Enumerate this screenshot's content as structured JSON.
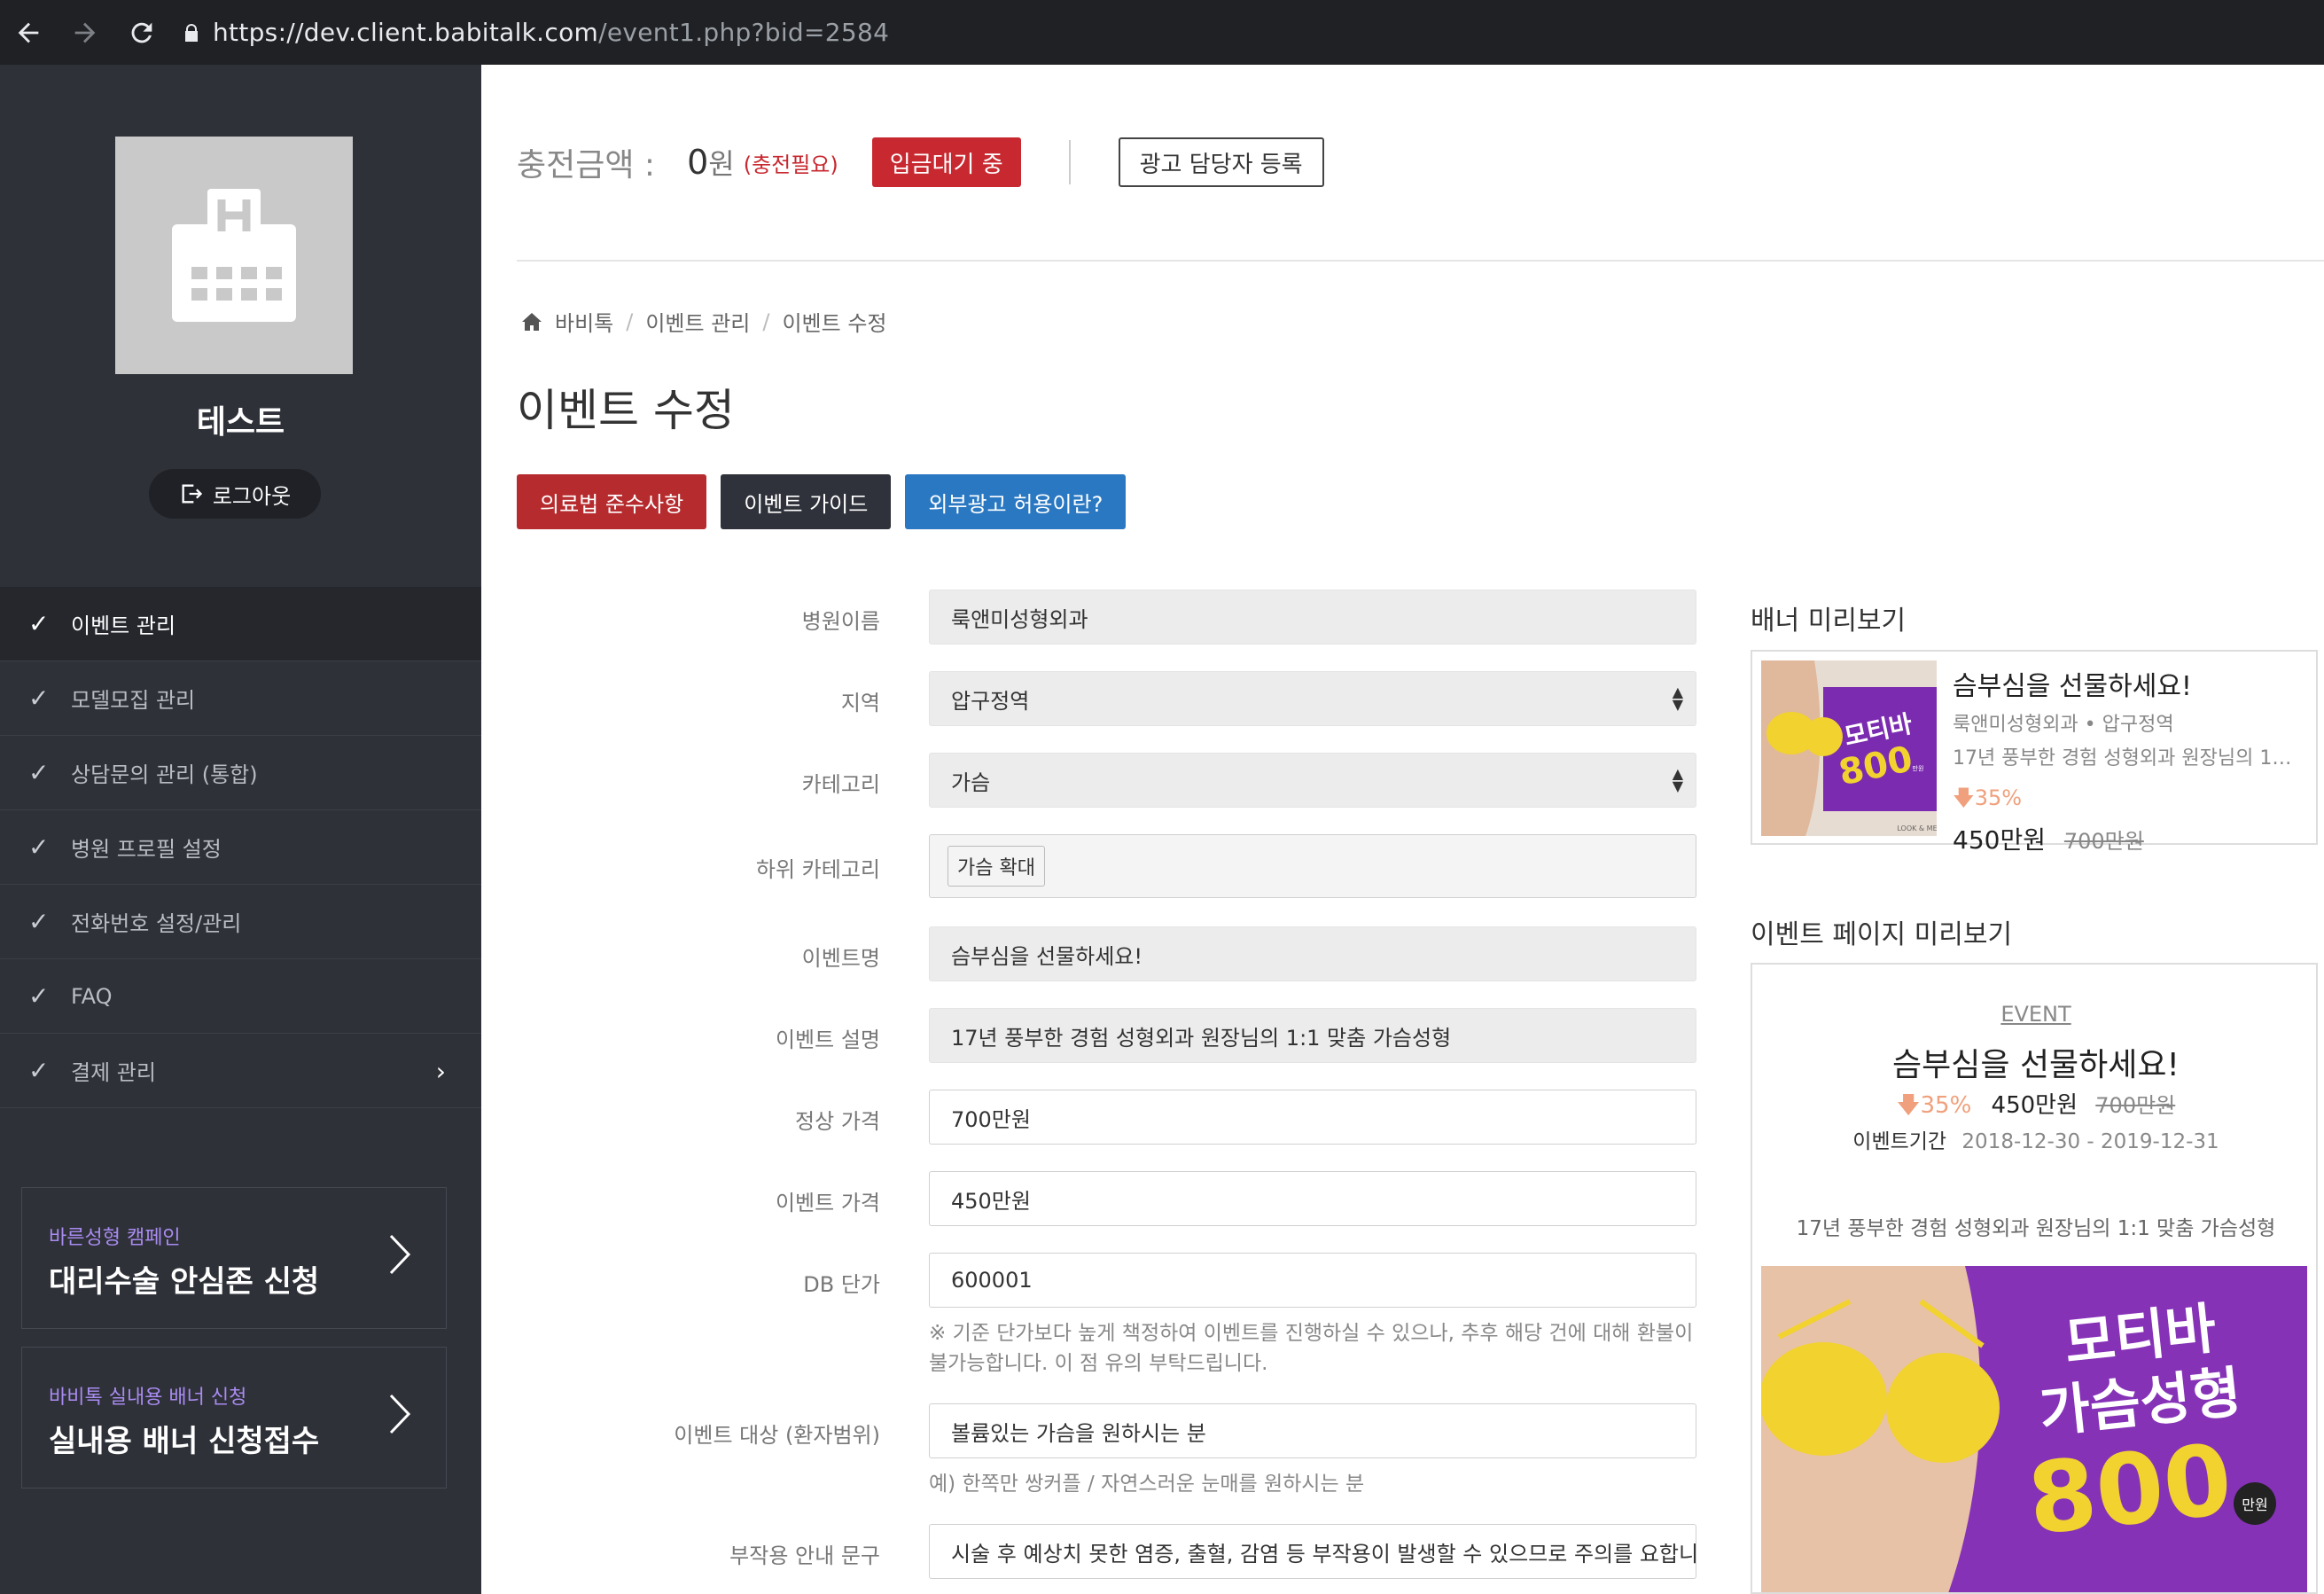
{
  "browser": {
    "url_host": "https://dev.client.babitalk.com",
    "url_path": "/event1.php?bid=2584"
  },
  "sidebar": {
    "clinic_name": "테스트",
    "logout_label": "로그아웃",
    "menu": [
      {
        "label": "이벤트 관리",
        "active": true
      },
      {
        "label": "모델모집 관리"
      },
      {
        "label": "상담문의 관리 (통합)"
      },
      {
        "label": "병원 프로필 설정"
      },
      {
        "label": "전화번호 설정/관리"
      },
      {
        "label": "FAQ"
      },
      {
        "label": "결제 관리",
        "has_arrow": true
      }
    ],
    "promos": [
      {
        "small": "바른성형 캠페인",
        "big": "대리수술 안심존 신청"
      },
      {
        "small": "바비톡 실내용 배너 신청",
        "big": "실내용 배너 신청접수"
      }
    ]
  },
  "header": {
    "charge_label": "충전금액 :",
    "charge_amount": "0",
    "charge_unit": "원",
    "charge_need": "(충전필요)",
    "deposit_status": "입금대기 중",
    "register_manager": "광고 담당자 등록"
  },
  "breadcrumb": {
    "home": "바비톡",
    "sep": "/",
    "level1": "이벤트 관리",
    "level2": "이벤트 수정"
  },
  "page_title": "이벤트 수정",
  "action_buttons": {
    "medical_law": "의료법 준수사항",
    "event_guide": "이벤트 가이드",
    "external_ad": "외부광고 허용이란?"
  },
  "form": {
    "hospital_name": {
      "label": "병원이름",
      "value": "룩앤미성형외과"
    },
    "region": {
      "label": "지역",
      "value": "압구정역"
    },
    "category": {
      "label": "카테고리",
      "value": "가슴"
    },
    "subcategory": {
      "label": "하위 카테고리",
      "tag": "가슴 확대"
    },
    "event_name": {
      "label": "이벤트명",
      "value": "슴부심을 선물하세요!"
    },
    "event_desc": {
      "label": "이벤트 설명",
      "value": "17년 풍부한 경험 성형외과  원장님의 1:1  맞춤 가슴성형"
    },
    "regular_price": {
      "label": "정상 가격",
      "value": "700만원"
    },
    "event_price": {
      "label": "이벤트 가격",
      "value": "450만원"
    },
    "db_price": {
      "label": "DB 단가",
      "value": "600001",
      "hint": "※ 기준 단가보다 높게 책정하여 이벤트를 진행하실 수 있으나, 추후 해당 건에 대해 환불이 불가능합니다. 이 점 유의 부탁드립니다."
    },
    "target": {
      "label": "이벤트 대상 (환자범위)",
      "value": "볼륨있는 가슴을 원하시는 분",
      "hint": "예) 한쪽만 쌍커플 / 자연스러운 눈매를 원하시는 분"
    },
    "side_effect": {
      "label": "부작용 안내 문구",
      "value": "시술 후 예상치 못한 염증, 출혈, 감염 등 부작용이 발생할 수 있으므로 주의를 요합니다."
    }
  },
  "banner_preview": {
    "section_title": "배너 미리보기",
    "title": "슴부심을 선물하세요!",
    "subtitle": "룩앤미성형외과 • 압구정역",
    "desc": "17년 풍부한 경험 성형외과 원장님의 1…",
    "discount": "35%",
    "price": "450만원",
    "original_price": "700만원",
    "image_text": [
      "모티바",
      "800"
    ],
    "image_unit": "만원",
    "image_logo": "LOOK & ME"
  },
  "event_preview": {
    "section_title": "이벤트 페이지 미리보기",
    "label": "EVENT",
    "title": "슴부심을 선물하세요!",
    "discount": "35%",
    "price": "450만원",
    "original_price": "700만원",
    "period_label": "이벤트기간",
    "period": "2018-12-30 - 2019-12-31",
    "desc": "17년 풍부한 경험 성형외과 원장님의 1:1 맞춤 가슴성형",
    "image_text": [
      "모티바",
      "가슴성형",
      "800"
    ],
    "image_unit": "만원"
  },
  "colors": {
    "sidebar_bg": "#2e3138",
    "red": "#c8282f",
    "dark": "#2f323a",
    "blue": "#2a78c2",
    "purple": "#7b2bb0",
    "yellow": "#f1d22e"
  }
}
